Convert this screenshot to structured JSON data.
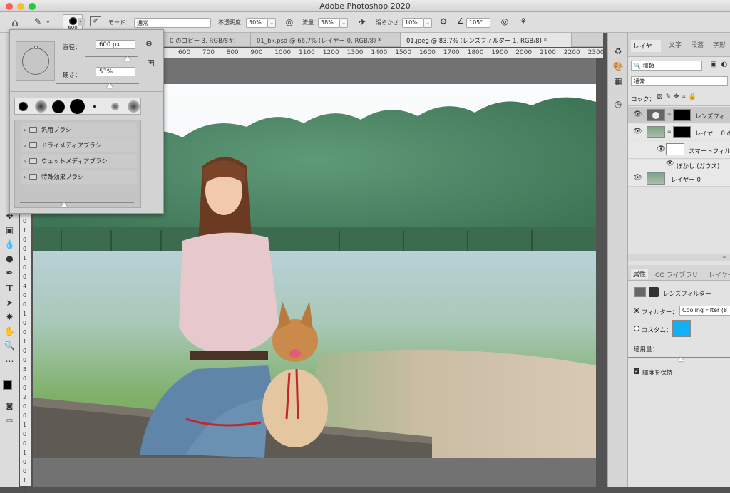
{
  "app": {
    "title": "Adobe Photoshop 2020"
  },
  "options_bar": {
    "brush_size": "600",
    "mode_label": "モード：",
    "mode_value": "通常",
    "opacity_label": "不透明度：",
    "opacity_value": "50%",
    "flow_label": "流量：",
    "flow_value": "58%",
    "smoothing_label": "滑らかさ：",
    "smoothing_value": "10%",
    "angle_value": "105°"
  },
  "tabs": [
    {
      "label": "0 のコピー 3, RGB/8#)"
    },
    {
      "label": "01_bk.psd @ 66.7% (レイヤー 0, RGB/8) *"
    },
    {
      "label": "01.jpeg @ 83.7% (レンズフィルター 1, RGB/8) *"
    }
  ],
  "ruler": {
    "ticks": [
      "600",
      "700",
      "800",
      "900",
      "1000",
      "1100",
      "1200",
      "1300",
      "1400",
      "1500",
      "1600",
      "1700",
      "1800",
      "1900",
      "2000",
      "2100",
      "2200",
      "2300"
    ]
  },
  "ruler_v": {
    "ticks": [
      "0",
      "1",
      "0",
      "0",
      "1",
      "0",
      "0",
      "4",
      "0",
      "0",
      "1",
      "0",
      "0",
      "1",
      "0",
      "0",
      "5",
      "0",
      "0",
      "2",
      "0",
      "0",
      "1",
      "0",
      "0",
      "1",
      "0",
      "0",
      "1",
      "0"
    ]
  },
  "brush_popup": {
    "diameter_label": "直径：",
    "diameter_value": "600 px",
    "hardness_label": "硬さ：",
    "hardness_value": "53%",
    "diameter_fraction": 0.8,
    "hardness_fraction": 0.53,
    "folders": [
      {
        "label": "汎用ブラシ"
      },
      {
        "label": "ドライメディアブラシ"
      },
      {
        "label": "ウェットメディアブラシ"
      },
      {
        "label": "特殊効果ブラシ"
      }
    ]
  },
  "layers_panel": {
    "tabs": [
      "レイヤー",
      "文字",
      "段落",
      "字形"
    ],
    "filter_value": "種類",
    "blend_mode": "通常",
    "lock_label": "ロック：",
    "layers": [
      {
        "name": "レンズフィ"
      },
      {
        "name": "レイヤー 0 の"
      },
      {
        "name": "スマートフィル"
      },
      {
        "name": "ぼかし (ガウス)"
      },
      {
        "name": "レイヤー 0"
      }
    ]
  },
  "properties_panel": {
    "tabs": [
      "属性",
      "CC ライブラリ",
      "レイヤー"
    ],
    "title": "レンズフィルター",
    "filter_label": "フィルター：",
    "filter_value": "Cooling Filter (8",
    "custom_label": "カスタム：",
    "custom_color": "#14b0f5",
    "amount_label": "適用量：",
    "preserve_label": "輝度を保持"
  },
  "colors": {
    "accent": "#14b0f5",
    "close": "#fc5f57",
    "minimize": "#fdbc2e",
    "zoom": "#28c840"
  }
}
